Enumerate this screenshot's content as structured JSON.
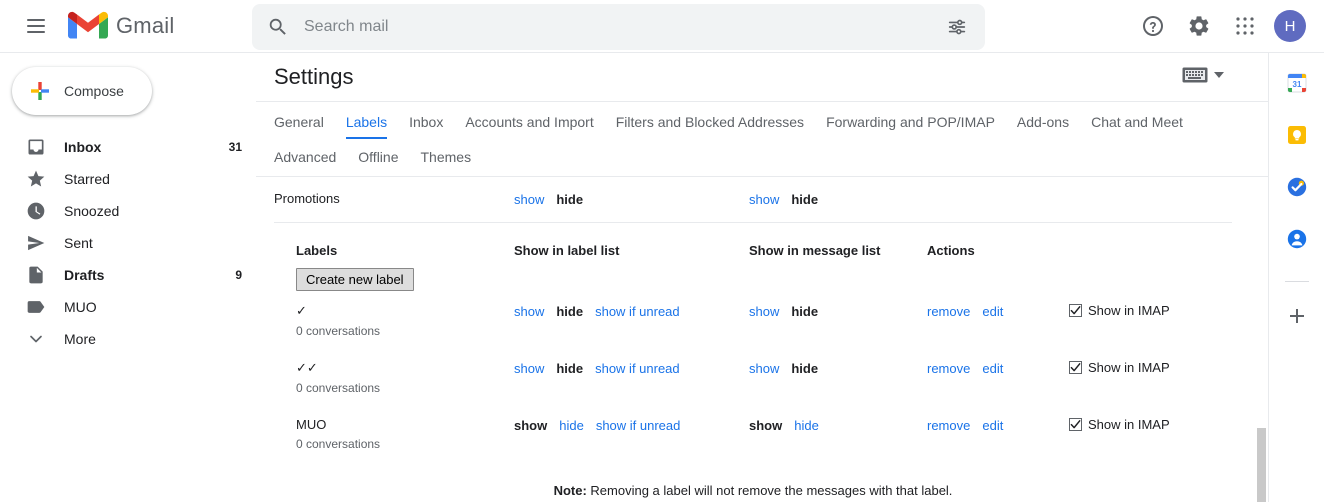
{
  "colors": {
    "accent": "#1a73e8",
    "avatar_bg": "#5f6bc0",
    "search_bg": "#f1f3f4",
    "text_primary": "#202124",
    "text_secondary": "#5f6368"
  },
  "topbar": {
    "menu_icon": "hamburger-icon",
    "brand": "Gmail",
    "search": {
      "icon": "search-icon",
      "placeholder": "Search mail",
      "value": "",
      "options_icon": "search-options-icon"
    },
    "help_icon": "help-icon",
    "settings_icon": "gear-icon",
    "apps_icon": "apps-grid-icon",
    "avatar_initial": "H"
  },
  "sidebar": {
    "compose": {
      "label": "Compose",
      "icon": "plus-icon"
    },
    "items": [
      {
        "icon": "inbox-icon",
        "label": "Inbox",
        "count": "31",
        "bold": true
      },
      {
        "icon": "star-icon",
        "label": "Starred",
        "count": "",
        "bold": false
      },
      {
        "icon": "clock-icon",
        "label": "Snoozed",
        "count": "",
        "bold": false
      },
      {
        "icon": "send-icon",
        "label": "Sent",
        "count": "",
        "bold": false
      },
      {
        "icon": "draft-icon",
        "label": "Drafts",
        "count": "9",
        "bold": true
      },
      {
        "icon": "label-icon",
        "label": "MUO",
        "count": "",
        "bold": false
      },
      {
        "icon": "chevron-down-icon",
        "label": "More",
        "count": "",
        "bold": false
      }
    ]
  },
  "settings": {
    "title": "Settings",
    "keyboard_icon": "keyboard-input-tools-icon",
    "tabs_row1": [
      {
        "label": "General",
        "active": false
      },
      {
        "label": "Labels",
        "active": true
      },
      {
        "label": "Inbox",
        "active": false
      },
      {
        "label": "Accounts and Import",
        "active": false
      },
      {
        "label": "Filters and Blocked Addresses",
        "active": false
      },
      {
        "label": "Forwarding and POP/IMAP",
        "active": false
      },
      {
        "label": "Add-ons",
        "active": false
      },
      {
        "label": "Chat and Meet",
        "active": false
      }
    ],
    "tabs_row2": [
      {
        "label": "Advanced",
        "active": false
      },
      {
        "label": "Offline",
        "active": false
      },
      {
        "label": "Themes",
        "active": false
      }
    ],
    "system_rows": [
      {
        "name": "Promotions",
        "label_list": {
          "show": "show",
          "hide": "hide",
          "current": "hide"
        },
        "message_list": {
          "show": "show",
          "hide": "hide",
          "current": "hide"
        }
      }
    ],
    "headers": {
      "labels": "Labels",
      "show_in_label_list": "Show in label list",
      "show_in_message_list": "Show in message list",
      "actions": "Actions"
    },
    "create_new_label": "Create new label",
    "link_labels": {
      "show": "show",
      "hide": "hide",
      "show_if_unread": "show if unread",
      "remove": "remove",
      "edit": "edit",
      "show_in_imap": "Show in IMAP"
    },
    "labels": [
      {
        "name": "✓",
        "conversations": "0 conversations",
        "label_list_current": "hide",
        "message_list_current": "hide",
        "imap_checked": true
      },
      {
        "name": "✓✓",
        "conversations": "0 conversations",
        "label_list_current": "hide",
        "message_list_current": "hide",
        "imap_checked": true
      },
      {
        "name": "MUO",
        "conversations": "0 conversations",
        "label_list_current": "show",
        "message_list_current": "show",
        "imap_checked": true
      }
    ],
    "note_prefix": "Note:",
    "note_text": " Removing a label will not remove the messages with that label."
  },
  "right_rail": {
    "items": [
      {
        "icon": "google-calendar-icon"
      },
      {
        "icon": "google-keep-icon"
      },
      {
        "icon": "google-tasks-icon"
      },
      {
        "icon": "google-contacts-icon"
      }
    ],
    "add_icon": "plus-icon"
  }
}
